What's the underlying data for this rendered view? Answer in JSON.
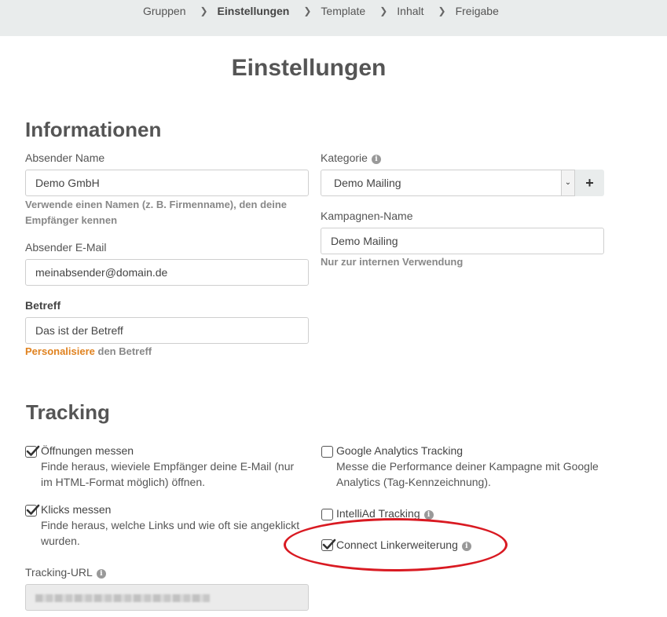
{
  "breadcrumb": {
    "items": [
      "Gruppen",
      "Einstellungen",
      "Template",
      "Inhalt",
      "Freigabe"
    ],
    "active_index": 1
  },
  "page": {
    "title": "Einstellungen"
  },
  "informationen": {
    "heading": "Informationen",
    "sender_name": {
      "label": "Absender Name",
      "value": "Demo GmbH",
      "help": "Verwende einen Namen (z. B. Firmenname), den deine Empfänger kennen"
    },
    "sender_email": {
      "label": "Absender E-Mail",
      "value": "meinabsender@domain.de"
    },
    "subject": {
      "label": "Betreff",
      "value": "Das ist der Betreff",
      "help_link": "Personalisiere",
      "help_rest": " den Betreff"
    },
    "category": {
      "label": "Kategorie",
      "value": "Demo Mailing",
      "add_label": "+"
    },
    "campaign_name": {
      "label": "Kampagnen-Name",
      "value": "Demo Mailing",
      "help": "Nur zur internen Verwendung"
    }
  },
  "tracking": {
    "heading": "Tracking",
    "opens": {
      "label": "Öffnungen messen",
      "checked": true,
      "desc_1": "Finde heraus, wieviele Empfänger deine E-Mail (nur",
      "desc_2": "im HTML-Format möglich) öffnen."
    },
    "clicks": {
      "label": "Klicks messen",
      "checked": true,
      "desc_1": "Finde heraus, welche Links und wie oft sie angeklickt",
      "desc_2": "wurden."
    },
    "google": {
      "label": "Google Analytics Tracking",
      "checked": false,
      "desc_1": "Messe die Performance deiner Kampagne mit Google",
      "desc_2": "Analytics (Tag-Kennzeichnung)."
    },
    "intelliad": {
      "label": "IntelliAd Tracking",
      "checked": false
    },
    "connect": {
      "label": "Connect Linkerweiterung",
      "checked": true
    },
    "tracking_url": {
      "label": "Tracking-URL"
    }
  },
  "colors": {
    "accent_orange": "#e0821f",
    "annotation_red": "#d91a22",
    "topbar_bg": "#e9ecec"
  }
}
